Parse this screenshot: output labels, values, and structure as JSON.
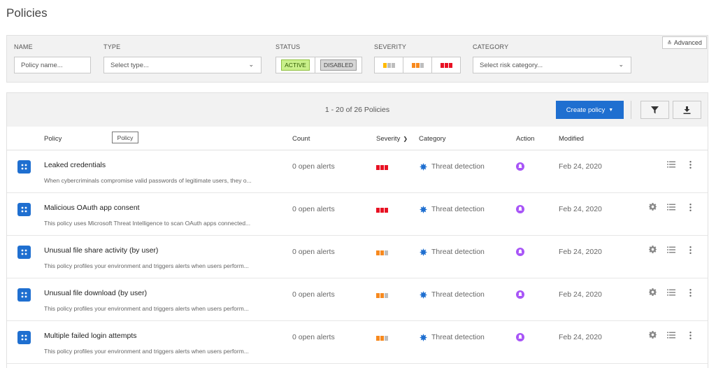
{
  "page": {
    "title": "Policies"
  },
  "filters": {
    "name_label": "NAME",
    "name_placeholder": "Policy name...",
    "type_label": "TYPE",
    "type_value": "Select type...",
    "status_label": "STATUS",
    "status_active": "ACTIVE",
    "status_disabled": "DISABLED",
    "severity_label": "SEVERITY",
    "category_label": "CATEGORY",
    "category_value": "Select risk category...",
    "advanced": "Advanced"
  },
  "toolbar": {
    "count_text": "1 - 20 of 26 Policies",
    "create_label": "Create policy"
  },
  "columns": {
    "policy": "Policy",
    "tooltip": "Policy",
    "count": "Count",
    "severity": "Severity",
    "category": "Category",
    "action": "Action",
    "modified": "Modified"
  },
  "colors": {
    "high": "#e81123",
    "medium": "#f7891e",
    "low": "#ffb900",
    "gray": "#bdbdbd",
    "accent": "#1f6fd0",
    "action": "#a855f7"
  },
  "rows": [
    {
      "name": "Leaked credentials",
      "desc": "When cybercriminals compromise valid passwords of legitimate users, they o...",
      "count": "0 open alerts",
      "severity": "high",
      "category": "Threat detection",
      "modified": "Feb 24, 2020",
      "has_gear": false
    },
    {
      "name": "Malicious OAuth app consent",
      "desc": "This policy uses Microsoft Threat Intelligence to scan OAuth apps connected...",
      "count": "0 open alerts",
      "severity": "high",
      "category": "Threat detection",
      "modified": "Feb 24, 2020",
      "has_gear": true
    },
    {
      "name": "Unusual file share activity (by user)",
      "desc": "This policy profiles your environment and triggers alerts when users perform...",
      "count": "0 open alerts",
      "severity": "medium",
      "category": "Threat detection",
      "modified": "Feb 24, 2020",
      "has_gear": true
    },
    {
      "name": "Unusual file download (by user)",
      "desc": "This policy profiles your environment and triggers alerts when users perform...",
      "count": "0 open alerts",
      "severity": "medium",
      "category": "Threat detection",
      "modified": "Feb 24, 2020",
      "has_gear": true
    },
    {
      "name": "Multiple failed login attempts",
      "desc": "This policy profiles your environment and triggers alerts when users perform...",
      "count": "0 open alerts",
      "severity": "medium",
      "category": "Threat detection",
      "modified": "Feb 24, 2020",
      "has_gear": true
    }
  ]
}
